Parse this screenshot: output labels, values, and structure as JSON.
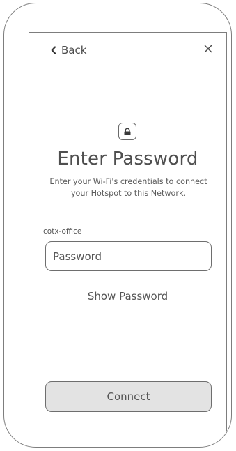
{
  "header": {
    "back_label": "Back",
    "back_icon": "chevron-left-icon",
    "close_icon": "close-icon"
  },
  "main": {
    "lock_icon": "lock-icon",
    "title": "Enter Password",
    "subtitle": "Enter your Wi-Fi's credentials to connect your Hotspot to this Network.",
    "network_name": "cotx-office",
    "password_field": {
      "placeholder": "Password",
      "value": ""
    },
    "show_password_label": "Show Password",
    "connect_label": "Connect"
  },
  "colors": {
    "outline": "#7d7d7d",
    "text": "#555555",
    "button_fill": "#e3e3e3"
  }
}
